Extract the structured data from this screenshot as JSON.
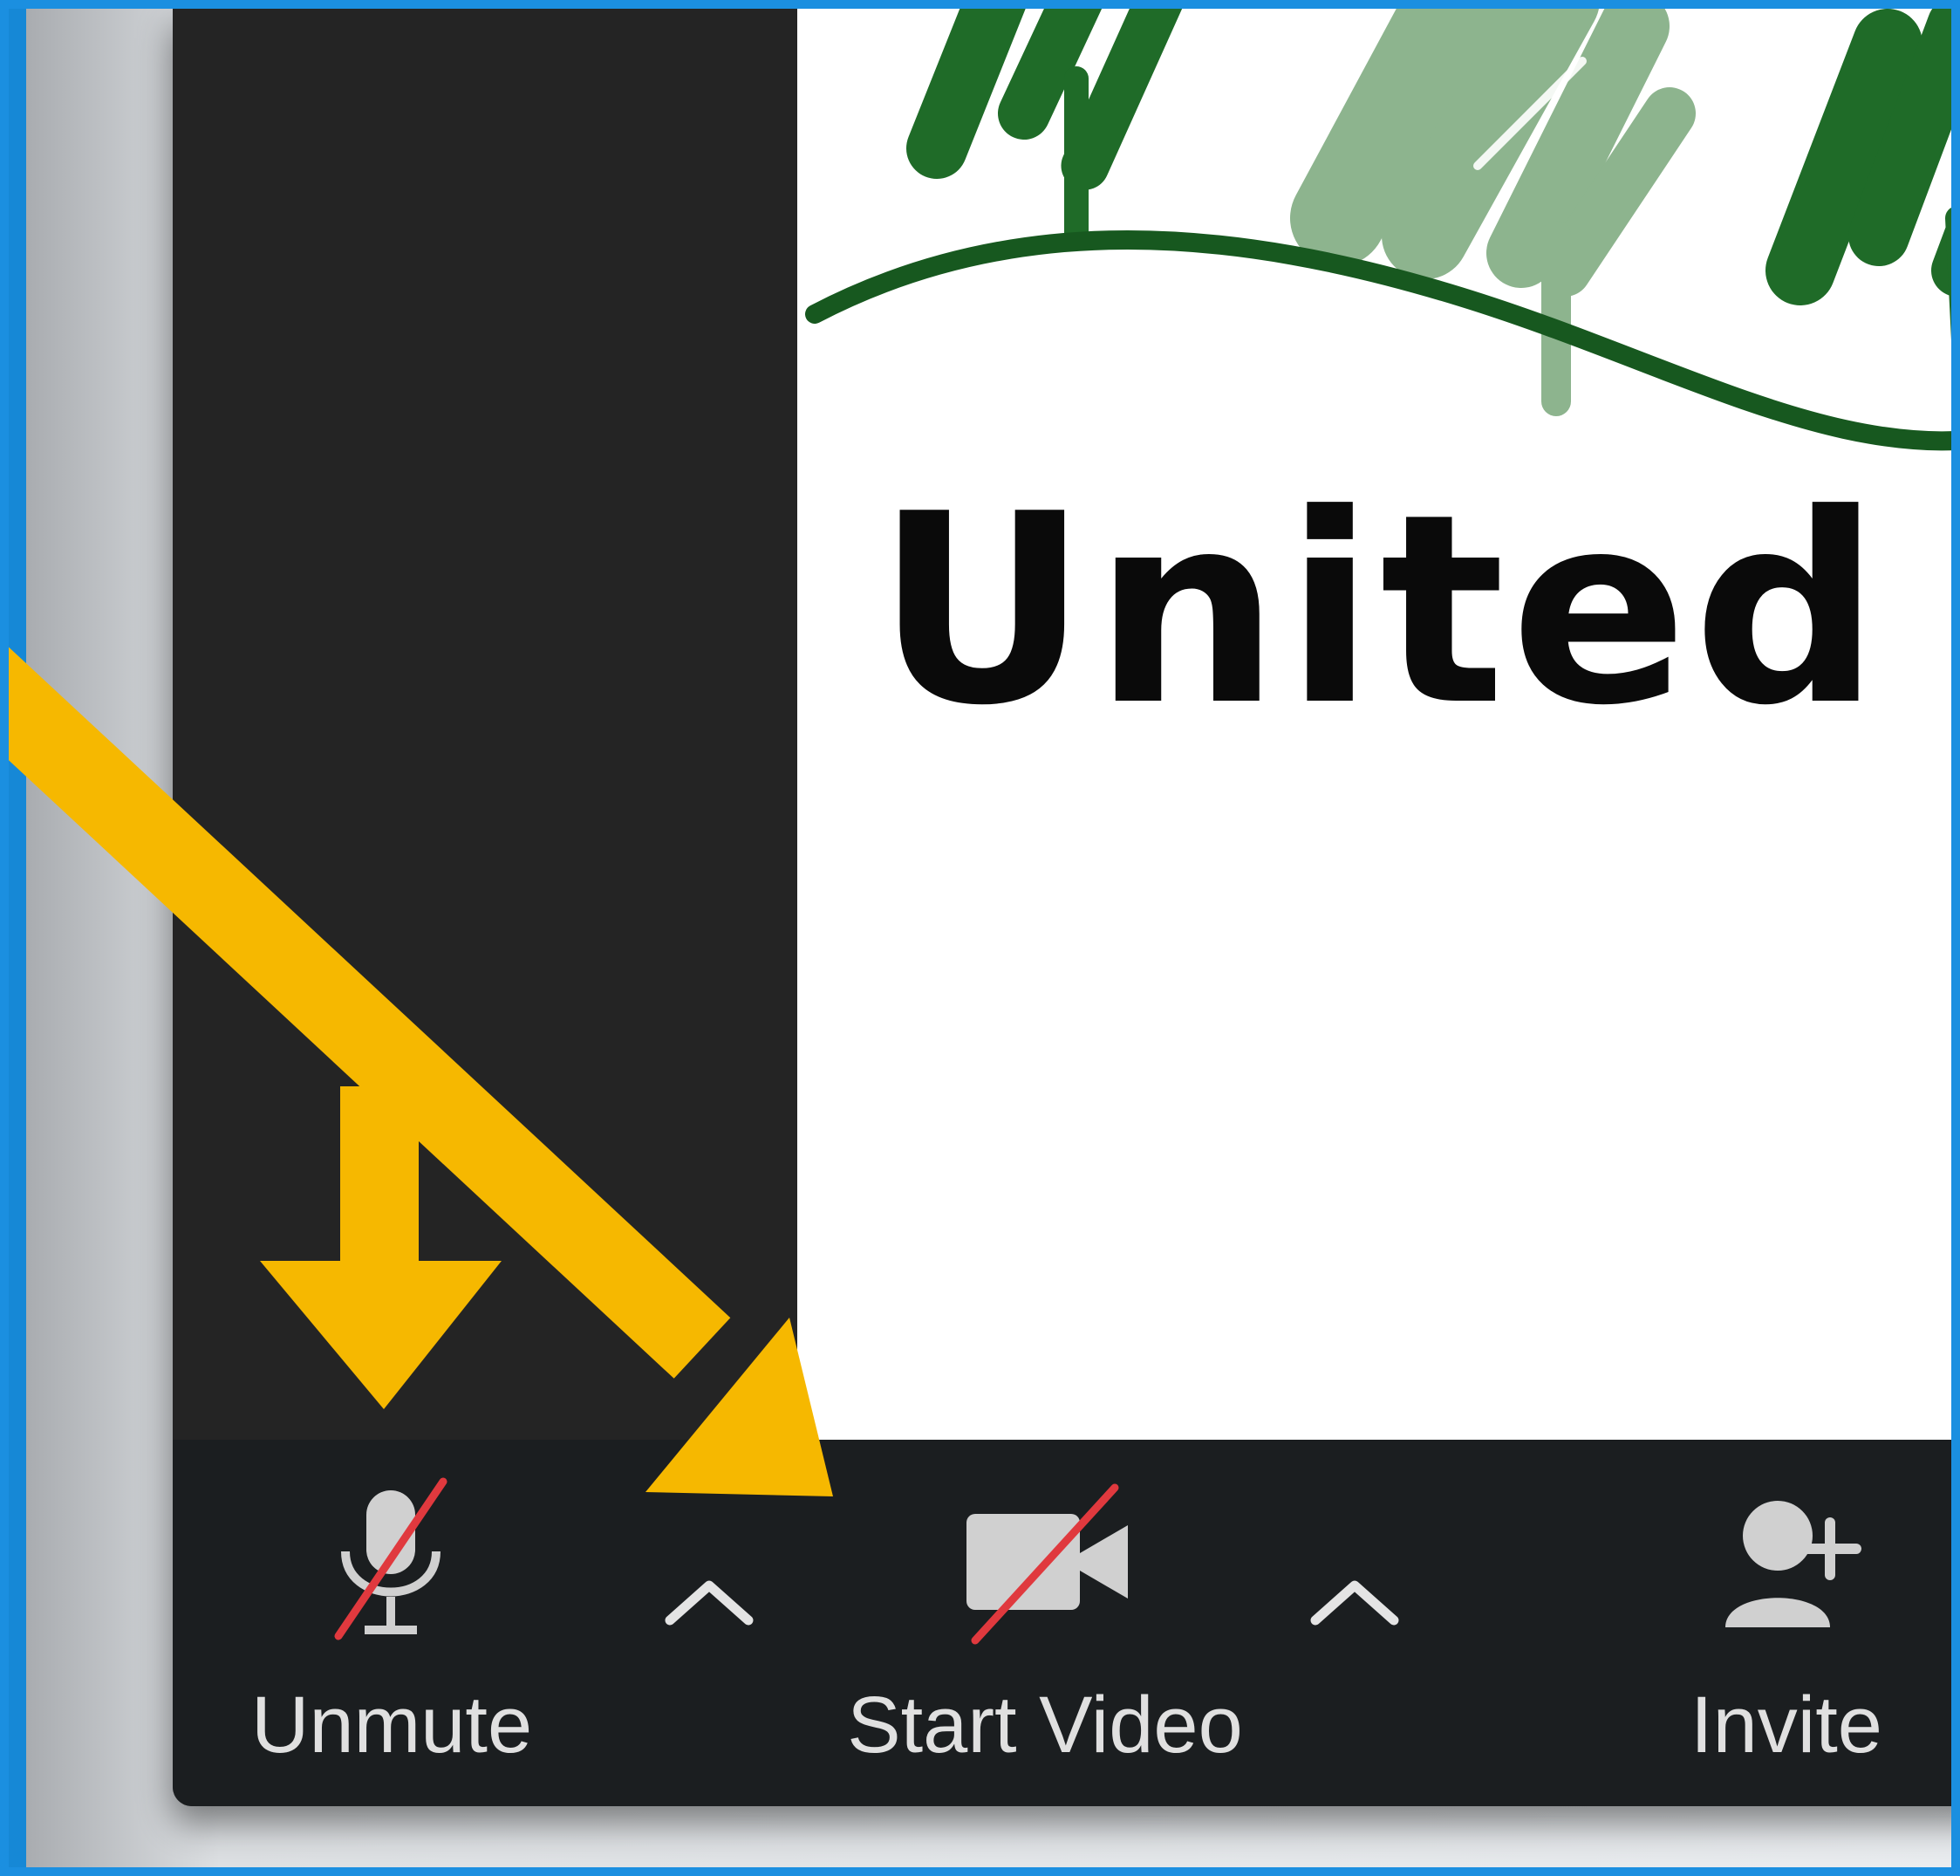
{
  "shared_content": {
    "logo_text": "United Me"
  },
  "toolbar": {
    "unmute_label": "Unmute",
    "start_video_label": "Start Video",
    "invite_label": "Invite"
  },
  "colors": {
    "accent_arrow": "#f6b800",
    "toolbar_bg": "#1b1e20",
    "window_bg": "#242424",
    "muted_slash": "#e0393e",
    "frame_blue": "#1b8fe0"
  },
  "icons": [
    "microphone-muted-icon",
    "video-camera-off-icon",
    "chevron-up-icon",
    "add-person-icon"
  ]
}
